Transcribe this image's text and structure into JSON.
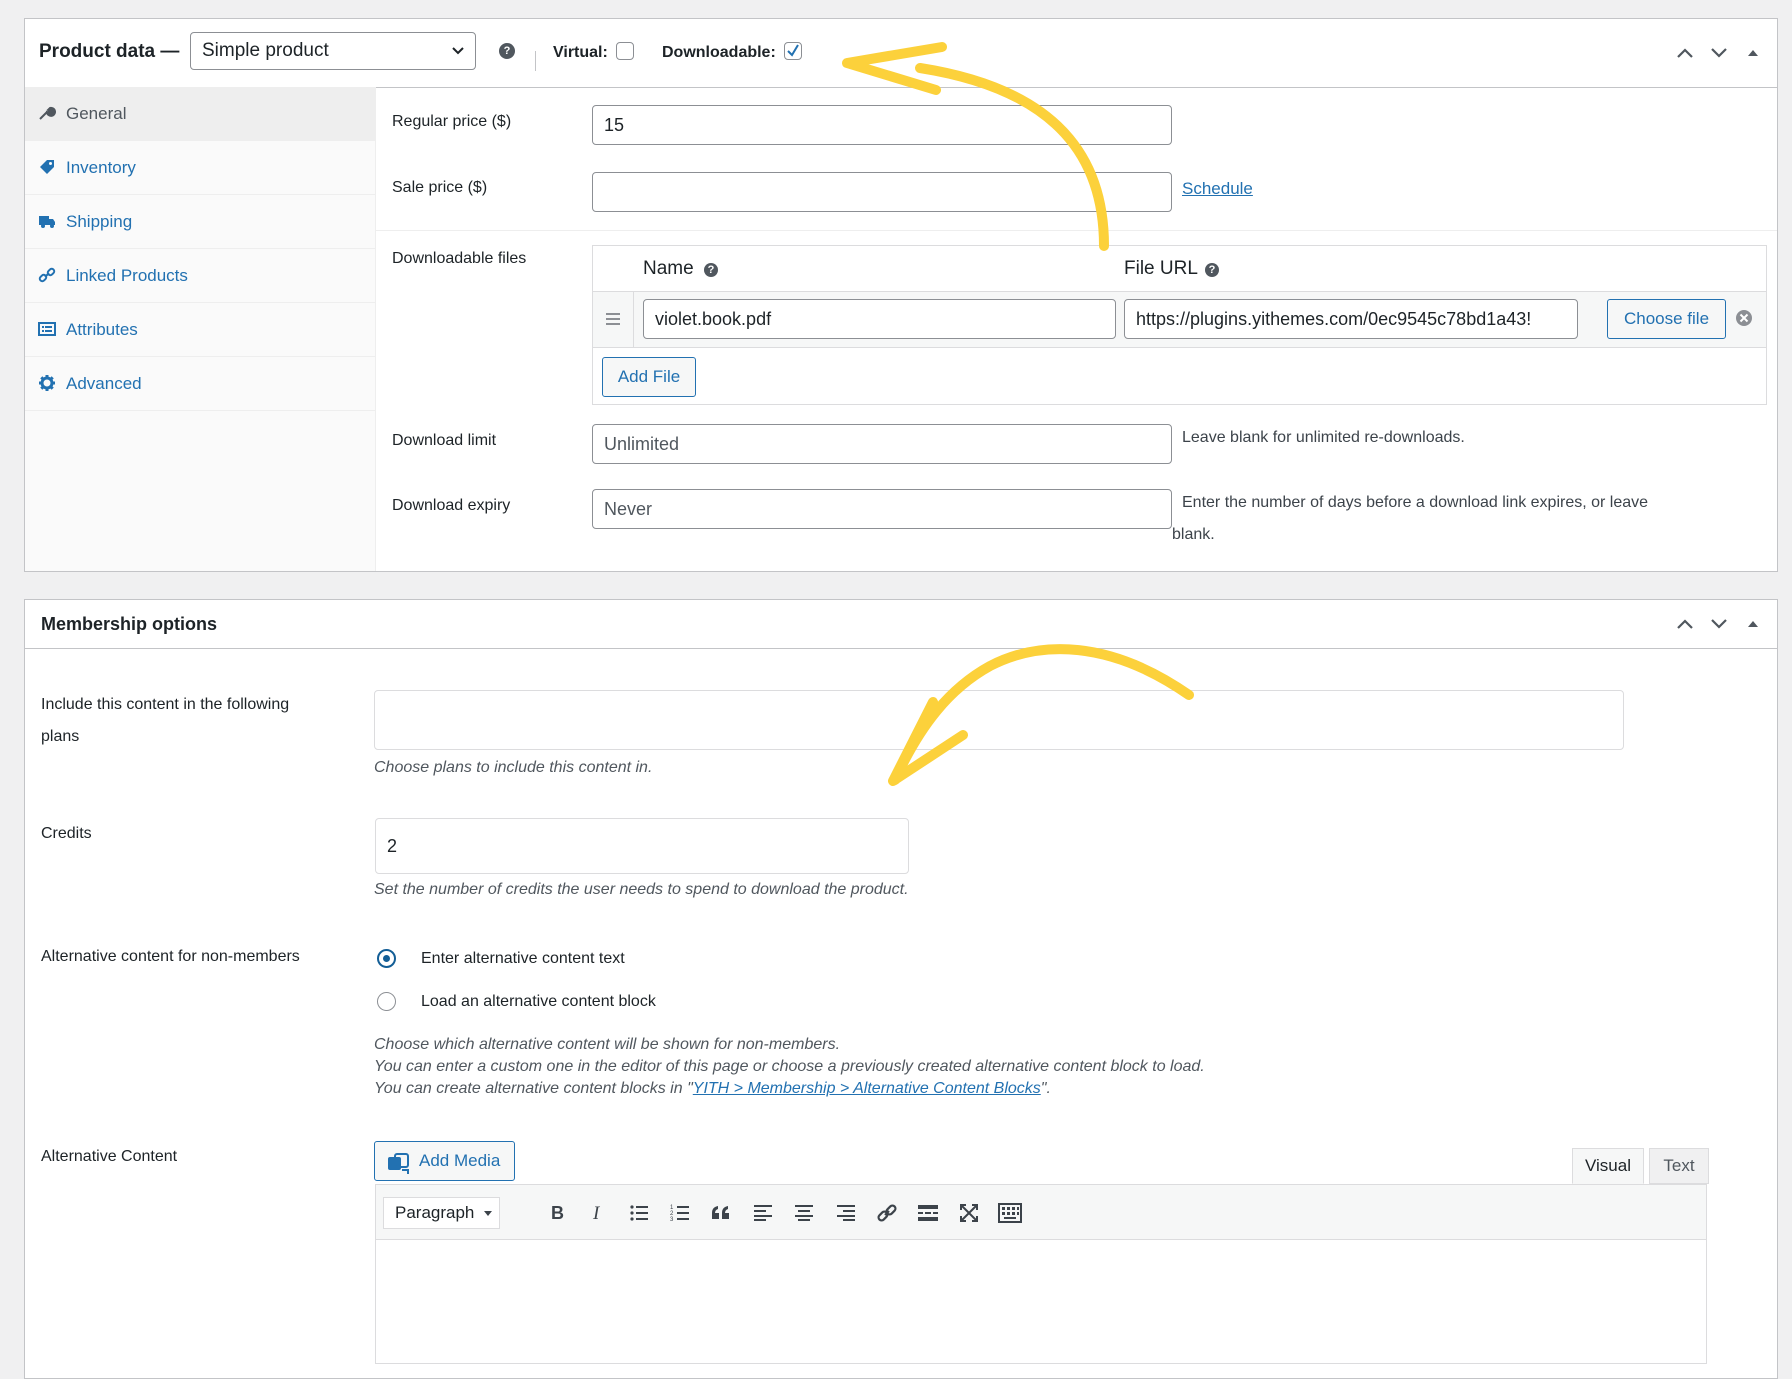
{
  "product_data": {
    "title": "Product data —",
    "product_type": "Simple product",
    "virtual_label": "Virtual:",
    "virtual_checked": false,
    "downloadable_label": "Downloadable:",
    "downloadable_checked": true,
    "tabs": [
      {
        "label": "General",
        "icon": "wrench-icon",
        "active": true
      },
      {
        "label": "Inventory",
        "icon": "tag-icon"
      },
      {
        "label": "Shipping",
        "icon": "truck-icon"
      },
      {
        "label": "Linked Products",
        "icon": "link-icon"
      },
      {
        "label": "Attributes",
        "icon": "list-icon"
      },
      {
        "label": "Advanced",
        "icon": "gear-icon"
      }
    ],
    "general": {
      "regular_price_label": "Regular price ($)",
      "regular_price_value": "15",
      "sale_price_label": "Sale price ($)",
      "sale_price_value": "",
      "schedule_link": "Schedule",
      "downloadable_files_label": "Downloadable files",
      "col_name": "Name",
      "col_file_url": "File URL",
      "file_name": "violet.book.pdf",
      "file_url": "https://plugins.yithemes.com/0ec9545c78bd1a43!",
      "choose_file": "Choose file",
      "add_file": "Add File",
      "download_limit_label": "Download limit",
      "download_limit_placeholder": "Unlimited",
      "download_limit_desc": "Leave blank for unlimited re-downloads.",
      "download_expiry_label": "Download expiry",
      "download_expiry_placeholder": "Never",
      "download_expiry_desc_1": "Enter the number of days before a download link expires, or leave",
      "download_expiry_desc_2": "blank."
    }
  },
  "membership": {
    "title": "Membership options",
    "plans_label_1": "Include this content in the following",
    "plans_label_2": "plans",
    "plans_value": "",
    "plans_desc": "Choose plans to include this content in.",
    "credits_label": "Credits",
    "credits_value": "2",
    "credits_desc": "Set the number of credits the user needs to spend to download the product.",
    "alt_label": "Alternative content for non-members",
    "radio_1": "Enter alternative content text",
    "radio_1_checked": true,
    "radio_2": "Load an alternative content block",
    "radio_2_checked": false,
    "alt_desc_1": "Choose which alternative content will be shown for non-members.",
    "alt_desc_2": "You can enter a custom one in the editor of this page or choose a previously created alternative content block to load.",
    "alt_desc_3_pre": "You can create alternative content blocks in \"",
    "alt_desc_3_link": "YITH > Membership > Alternative Content Blocks",
    "alt_desc_3_post": "\".",
    "alt_content_label": "Alternative Content",
    "add_media": "Add Media",
    "tab_visual": "Visual",
    "tab_text": "Text",
    "format_select": "Paragraph",
    "toolbar_icons": [
      "bold-icon",
      "italic-icon",
      "bullet-list-icon",
      "numbered-list-icon",
      "blockquote-icon",
      "align-left-icon",
      "align-center-icon",
      "align-right-icon",
      "link-icon",
      "read-more-icon",
      "fullscreen-icon",
      "keyboard-icon"
    ]
  },
  "colors": {
    "accent": "#2271b1",
    "arrow": "#fcd13b",
    "border": "#c3c4c7"
  }
}
